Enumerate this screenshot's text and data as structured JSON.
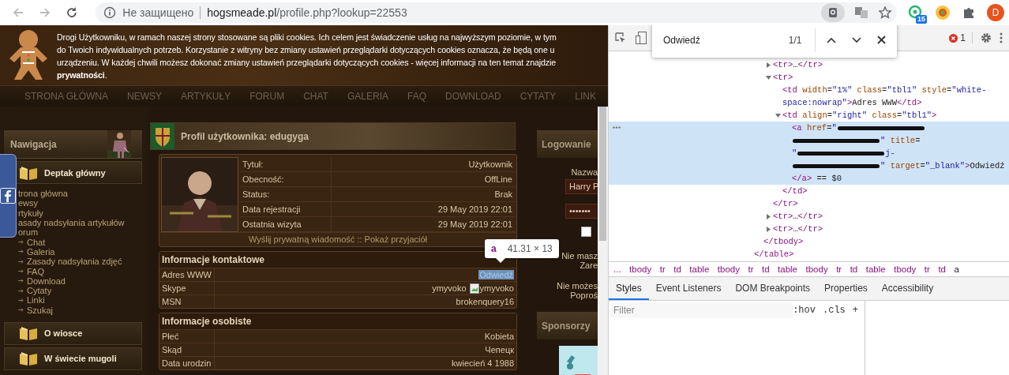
{
  "browser": {
    "security_label": "Не защищено",
    "url_host": "hogsmeade.pl",
    "url_path": "/profile.php?lookup=22553",
    "extension_badge": "15",
    "profile_initial": "D"
  },
  "cookie_banner": {
    "lines": [
      "Drogi Użytkowniku, w ramach naszej strony stosowane są pliki cookies. Ich celem jest świadczenie usług na najwyższym poziomie, w tym",
      "do Twoich indywidualnych potrzeb. Korzystanie z witryny bez zmiany ustawień przeglądarki dotyczących cookies oznacza, że będą one u",
      "urządzeniu. W każdej chwili możesz dokonać zmiany ustawień przeglądarki dotyczących cookies - więcej informacji na ten temat znajdzie",
      "**prywatności**."
    ]
  },
  "site_nav": [
    "STRONA GŁÓWNA",
    "NEWSY",
    "ARTYKUŁY",
    "FORUM",
    "CHAT",
    "GALERIA",
    "FAQ",
    "DOWNLOAD",
    "CYTATY",
    "LINK"
  ],
  "sidebar": {
    "title": "Nawigacja",
    "sections": [
      {
        "title": "Deptak główny",
        "items": [
          {
            "label": "trona główna",
            "arrow": false
          },
          {
            "label": "ewsy",
            "arrow": false
          },
          {
            "label": "rtykuły",
            "arrow": false
          },
          {
            "label": "asady nadsyłania artykułów",
            "arrow": false
          },
          {
            "label": "orum",
            "arrow": false
          },
          {
            "label": "Chat",
            "arrow": true
          },
          {
            "label": "Galeria",
            "arrow": true
          },
          {
            "label": "Zasady nadsyłania zdjęć",
            "arrow": true
          },
          {
            "label": "FAQ",
            "arrow": true
          },
          {
            "label": "Download",
            "arrow": true
          },
          {
            "label": "Cytaty",
            "arrow": true
          },
          {
            "label": "Linki",
            "arrow": true
          },
          {
            "label": "Szukaj",
            "arrow": true
          }
        ]
      },
      {
        "title": "O wiosce"
      },
      {
        "title": "W świecie mugoli"
      }
    ]
  },
  "profile": {
    "title": "Profil użytkownika: edugyga",
    "fields": [
      {
        "label": "Tytuł:",
        "value": "Użytkownik"
      },
      {
        "label": "Obecność:",
        "value": "OffLine"
      },
      {
        "label": "Status:",
        "value": "Brak"
      },
      {
        "label": "Data rejestracji",
        "value": "29 May 2019 22:01"
      },
      {
        "label": "Ostatnia wizyta",
        "value": "29 May 2019 22:01"
      }
    ],
    "links": [
      "Wyślij prywatną wiadomość",
      "Pokaż przyjaciół"
    ],
    "link_separator": "::",
    "sections": [
      {
        "title": "Informacje kontaktowe",
        "rows": [
          {
            "label": "Adres WWW",
            "kind": "link",
            "value": "Odwiedź",
            "highlighted": true
          },
          {
            "label": "Skype",
            "kind": "skype",
            "value": "ymyvoko",
            "image_alt": "ymyvoko"
          },
          {
            "label": "MSN",
            "kind": "text",
            "value": "brokenquery16"
          }
        ]
      },
      {
        "title": "Informacje osobiste",
        "rows": [
          {
            "label": "Płeć",
            "kind": "text",
            "value": "Kobieta"
          },
          {
            "label": "Skąd",
            "kind": "text",
            "value": "Чепецк"
          },
          {
            "label": "Data urodzin",
            "kind": "text",
            "value": "kwiecień 4 1988"
          }
        ]
      }
    ]
  },
  "inspect_tooltip": {
    "tag": "a",
    "size": "41.31 × 13"
  },
  "login": {
    "title": "Logowanie",
    "username_label": "Nazwa",
    "username_value": "Harry P",
    "password_value": "•••••••",
    "remember": false,
    "register_lines": [
      "Nie masz",
      "Zare"
    ],
    "reset_lines": [
      "Nie możes",
      "Poproś"
    ]
  },
  "sponsors": {
    "title": "Sponsorzy"
  },
  "devtools": {
    "error_count": "1",
    "find": {
      "query": "Odwiedź",
      "count": "1/1"
    },
    "dom_tree": {
      "nodes": [
        {
          "expanded": false,
          "selected": false,
          "lines": [
            [
              {
                "kind": "code",
                "text": "<tr>…</tr>"
              }
            ]
          ]
        },
        {
          "expanded": true,
          "selected": false,
          "lines": [
            [
              {
                "kind": "code",
                "text": "<tr>"
              }
            ]
          ],
          "close": "</tr>",
          "children": [
            {
              "selected": false,
              "lines": [
                [
                  {
                    "kind": "code",
                    "text": "<td width=\"1%\" class=\"tbl1\" style=\"white-"
                  }
                ],
                [
                  {
                    "kind": "code",
                    "text": "space:nowrap\">Adres WWW</td>"
                  }
                ]
              ]
            },
            {
              "expanded": true,
              "selected": false,
              "lines": [
                [
                  {
                    "kind": "code",
                    "text": "<td align=\"right\" class=\"tbl1\">"
                  }
                ]
              ],
              "close": "</td>",
              "children": [
                {
                  "selected": true,
                  "lines": [
                    [
                      {
                        "kind": "code",
                        "text": "<a href=\""
                      },
                      {
                        "kind": "redaction"
                      }
                    ],
                    [
                      {
                        "kind": "redaction"
                      },
                      {
                        "kind": "code",
                        "text": "\" title="
                      }
                    ],
                    [
                      {
                        "kind": "code",
                        "text": "\""
                      },
                      {
                        "kind": "redaction"
                      },
                      {
                        "kind": "code",
                        "text": "j-"
                      }
                    ],
                    [
                      {
                        "kind": "redaction"
                      },
                      {
                        "kind": "code",
                        "text": "\" target=\"_blank\">Odwiedź"
                      }
                    ],
                    [
                      {
                        "kind": "code",
                        "text": "</a> == $0"
                      }
                    ]
                  ]
                }
              ]
            }
          ]
        },
        {
          "expanded": false,
          "selected": false,
          "lines": [
            [
              {
                "kind": "code",
                "text": "<tr>…</tr>"
              }
            ]
          ]
        },
        {
          "expanded": false,
          "selected": false,
          "lines": [
            [
              {
                "kind": "code",
                "text": "<tr>…</tr>"
              }
            ]
          ]
        }
      ],
      "closing_tags": [
        "</tbody>",
        "</table>"
      ]
    },
    "breadcrumbs": [
      {
        "label": "...",
        "selected": false
      },
      {
        "label": "tbody",
        "selected": false
      },
      {
        "label": "tr",
        "selected": false
      },
      {
        "label": "td",
        "selected": false
      },
      {
        "label": "table",
        "selected": false
      },
      {
        "label": "tbody",
        "selected": false
      },
      {
        "label": "tr",
        "selected": false
      },
      {
        "label": "td",
        "selected": false
      },
      {
        "label": "table",
        "selected": false
      },
      {
        "label": "tbody",
        "selected": false
      },
      {
        "label": "tr",
        "selected": false
      },
      {
        "label": "td",
        "selected": false
      },
      {
        "label": "table",
        "selected": false
      },
      {
        "label": "tbody",
        "selected": false
      },
      {
        "label": "tr",
        "selected": false
      },
      {
        "label": "td",
        "selected": false
      },
      {
        "label": "a",
        "selected": true
      }
    ],
    "tabs": [
      {
        "label": "Styles",
        "selected": true
      },
      {
        "label": "Event Listeners",
        "selected": false
      },
      {
        "label": "DOM Breakpoints",
        "selected": false
      },
      {
        "label": "Properties",
        "selected": false
      },
      {
        "label": "Accessibility",
        "selected": false
      }
    ],
    "styles_filter": {
      "placeholder": "Filter"
    },
    "style_buttons": [
      ":hov",
      ".cls",
      "+"
    ]
  }
}
